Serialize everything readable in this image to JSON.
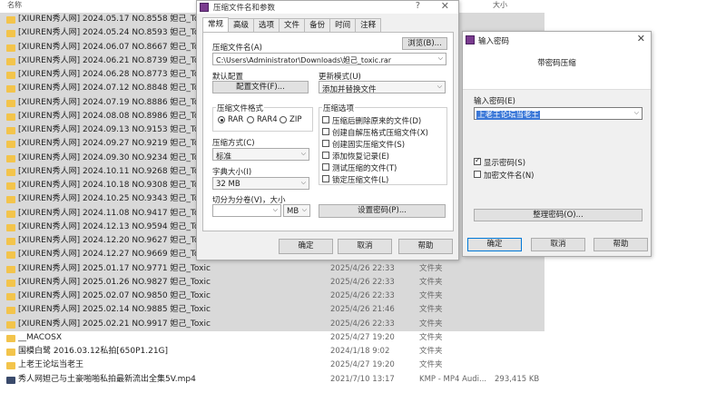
{
  "explorer": {
    "columns": {
      "name": "名称",
      "size": "大小"
    },
    "rows": [
      {
        "name": "[XIUREN秀人网] 2024.05.17 NO.8558 妲己_Toxic",
        "date": "",
        "type": "",
        "size": "",
        "icon": "folder-icon"
      },
      {
        "name": "[XIUREN秀人网] 2024.05.24 NO.8593 妲己_Toxic",
        "date": "",
        "type": "",
        "size": "",
        "icon": "folder-icon"
      },
      {
        "name": "[XIUREN秀人网] 2024.06.07 NO.8667 妲己_Toxic",
        "date": "",
        "type": "",
        "size": "",
        "icon": "folder-icon"
      },
      {
        "name": "[XIUREN秀人网] 2024.06.21 NO.8739 妲己_Toxic",
        "date": "",
        "type": "",
        "size": "",
        "icon": "folder-icon"
      },
      {
        "name": "[XIUREN秀人网] 2024.06.28 NO.8773 妲己_Toxic",
        "date": "",
        "type": "",
        "size": "",
        "icon": "folder-icon"
      },
      {
        "name": "[XIUREN秀人网] 2024.07.12 NO.8848 妲己_Toxic",
        "date": "",
        "type": "",
        "size": "",
        "icon": "folder-icon"
      },
      {
        "name": "[XIUREN秀人网] 2024.07.19 NO.8886 妲己_Toxic",
        "date": "",
        "type": "",
        "size": "",
        "icon": "folder-icon"
      },
      {
        "name": "[XIUREN秀人网] 2024.08.08 NO.8986 妲己_Toxic",
        "date": "",
        "type": "",
        "size": "",
        "icon": "folder-icon"
      },
      {
        "name": "[XIUREN秀人网] 2024.09.13 NO.9153 妲己_Toxic",
        "date": "",
        "type": "",
        "size": "",
        "icon": "folder-icon"
      },
      {
        "name": "[XIUREN秀人网] 2024.09.27 NO.9219 妲己_Toxic",
        "date": "",
        "type": "",
        "size": "",
        "icon": "folder-icon"
      },
      {
        "name": "[XIUREN秀人网] 2024.09.30 NO.9234 妲己_Toxic",
        "date": "",
        "type": "",
        "size": "",
        "icon": "folder-icon"
      },
      {
        "name": "[XIUREN秀人网] 2024.10.11 NO.9268 妲己_Toxic",
        "date": "",
        "type": "",
        "size": "",
        "icon": "folder-icon"
      },
      {
        "name": "[XIUREN秀人网] 2024.10.18 NO.9308 妲己_Toxic",
        "date": "",
        "type": "",
        "size": "",
        "icon": "folder-icon"
      },
      {
        "name": "[XIUREN秀人网] 2024.10.25 NO.9343 妲己_Toxic",
        "date": "",
        "type": "",
        "size": "",
        "icon": "folder-icon"
      },
      {
        "name": "[XIUREN秀人网] 2024.11.08 NO.9417 妲己_Toxic",
        "date": "",
        "type": "",
        "size": "",
        "icon": "folder-icon"
      },
      {
        "name": "[XIUREN秀人网] 2024.12.13 NO.9594 妲己_Toxic",
        "date": "",
        "type": "",
        "size": "",
        "icon": "folder-icon"
      },
      {
        "name": "[XIUREN秀人网] 2024.12.20 NO.9627 妲己_Toxic",
        "date": "",
        "type": "",
        "size": "",
        "icon": "folder-icon"
      },
      {
        "name": "[XIUREN秀人网] 2024.12.27 NO.9669 妲己_Toxic",
        "date": "",
        "type": "",
        "size": "",
        "icon": "folder-icon"
      },
      {
        "name": "[XIUREN秀人网] 2025.01.17 NO.9771 妲己_Toxic",
        "date": "2025/4/26 22:33",
        "type": "文件夹",
        "size": "",
        "icon": "folder-icon"
      },
      {
        "name": "[XIUREN秀人网] 2025.01.26 NO.9827 妲己_Toxic",
        "date": "2025/4/26 22:33",
        "type": "文件夹",
        "size": "",
        "icon": "folder-icon"
      },
      {
        "name": "[XIUREN秀人网] 2025.02.07 NO.9850 妲己_Toxic",
        "date": "2025/4/26 22:33",
        "type": "文件夹",
        "size": "",
        "icon": "folder-icon"
      },
      {
        "name": "[XIUREN秀人网] 2025.02.14 NO.9885 妲己_Toxic",
        "date": "2025/4/26 21:46",
        "type": "文件夹",
        "size": "",
        "icon": "folder-icon"
      },
      {
        "name": "[XIUREN秀人网] 2025.02.21 NO.9917 妲己_Toxic",
        "date": "2025/4/26 22:33",
        "type": "文件夹",
        "size": "",
        "icon": "folder-icon"
      },
      {
        "name": "__MACOSX",
        "date": "2025/4/27 19:20",
        "type": "文件夹",
        "size": "",
        "icon": "folder-icon"
      },
      {
        "name": "国模白鹭 2016.03.12私拍[650P1.21G]",
        "date": "2024/1/18 9:02",
        "type": "文件夹",
        "size": "",
        "icon": "folder-icon"
      },
      {
        "name": "上老王论坛当老王",
        "date": "2025/4/27 19:20",
        "type": "文件夹",
        "size": "",
        "icon": "folder-icon"
      },
      {
        "name": "秀人网妲己与土豪啪啪私拍最新流出全集5V.mp4",
        "date": "2021/7/10 13:17",
        "type": "KMP - MP4 Audi...",
        "size": "293,415 KB",
        "icon": "video-file-icon"
      }
    ]
  },
  "archive_dialog": {
    "title": "压缩文件名和参数",
    "help_glyph": "?",
    "close_glyph": "✕",
    "tabs": [
      "常规",
      "高级",
      "选项",
      "文件",
      "备份",
      "时间",
      "注释"
    ],
    "archive_name_label": "压缩文件名(A)",
    "browse_label": "浏览(B)...",
    "archive_name_value": "C:\\Users\\Administrator\\Downloads\\妲己_toxic.rar",
    "default_profile_label": "默认配置",
    "profile_button": "配置文件(F)...",
    "update_mode_label": "更新模式(U)",
    "update_mode_value": "添加并替换文件",
    "format_label": "压缩文件格式",
    "formats": [
      "RAR",
      "RAR4",
      "ZIP"
    ],
    "format_selected": "RAR",
    "options_label": "压缩选项",
    "options": [
      {
        "label": "压缩后删除原来的文件(D)",
        "checked": false
      },
      {
        "label": "创建自解压格式压缩文件(X)",
        "checked": false
      },
      {
        "label": "创建固实压缩文件(S)",
        "checked": false
      },
      {
        "label": "添加恢复记录(E)",
        "checked": false
      },
      {
        "label": "测试压缩的文件(T)",
        "checked": false
      },
      {
        "label": "锁定压缩文件(L)",
        "checked": false
      }
    ],
    "method_label": "压缩方式(C)",
    "method_value": "标准",
    "dict_label": "字典大小(I)",
    "dict_value": "32 MB",
    "split_label": "切分为分卷(V)，大小",
    "split_value": "",
    "split_unit": "MB",
    "set_password_button": "设置密码(P)...",
    "ok": "确定",
    "cancel": "取消",
    "help": "帮助"
  },
  "password_dialog": {
    "title": "输入密码",
    "close_glyph": "✕",
    "heading": "带密码压缩",
    "input_label": "输入密码(E)",
    "input_value": "上老王论坛当老王",
    "show_password_label": "显示密码(S)",
    "show_password_checked": true,
    "encrypt_names_label": "加密文件名(N)",
    "encrypt_names_checked": false,
    "organize_button": "整理密码(O)...",
    "ok": "确定",
    "cancel": "取消",
    "help": "帮助"
  },
  "colors": {
    "accent": "#3b78d8",
    "folder": "#f3c44b",
    "selection": "#d9d9d9"
  }
}
